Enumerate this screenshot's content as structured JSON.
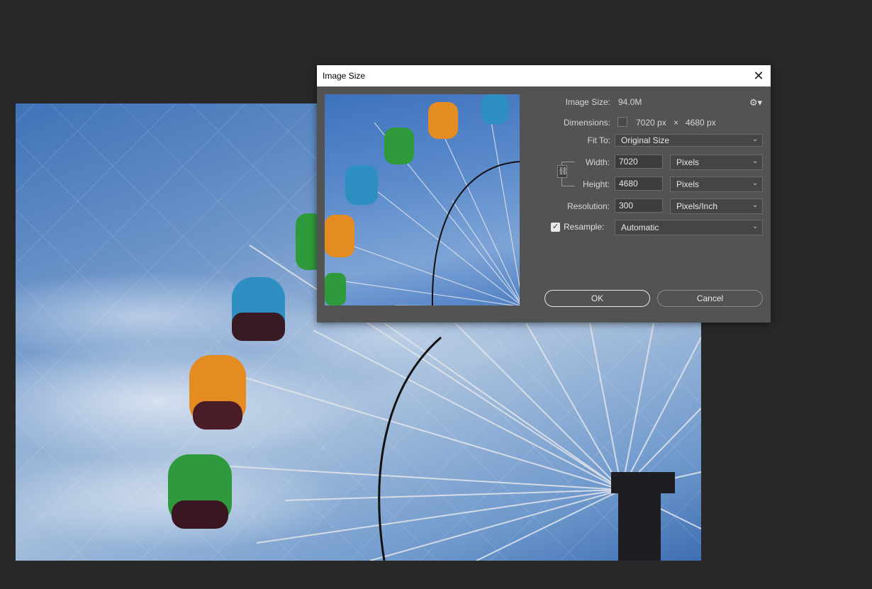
{
  "dialog": {
    "title": "Image Size",
    "close_glyph": "✕",
    "image_size_label": "Image Size:",
    "image_size_value": "94.0M",
    "settings_icon": "gear-icon",
    "dimensions_label": "Dimensions:",
    "dimensions_width": "7020 px",
    "dimensions_x": "×",
    "dimensions_height": "4680 px",
    "fit_to_label": "Fit To:",
    "fit_to_value": "Original Size",
    "width_label": "Width:",
    "width_value": "7020",
    "width_unit": "Pixels",
    "height_label": "Height:",
    "height_value": "4680",
    "height_unit": "Pixels",
    "resolution_label": "Resolution:",
    "resolution_value": "300",
    "resolution_unit": "Pixels/Inch",
    "resample_label": "Resample:",
    "resample_checked": true,
    "resample_value": "Automatic",
    "ok_label": "OK",
    "cancel_label": "Cancel"
  },
  "colors": {
    "workspace": "#282828",
    "dialog_bg": "#535353",
    "sky": "#4a7fc4"
  }
}
